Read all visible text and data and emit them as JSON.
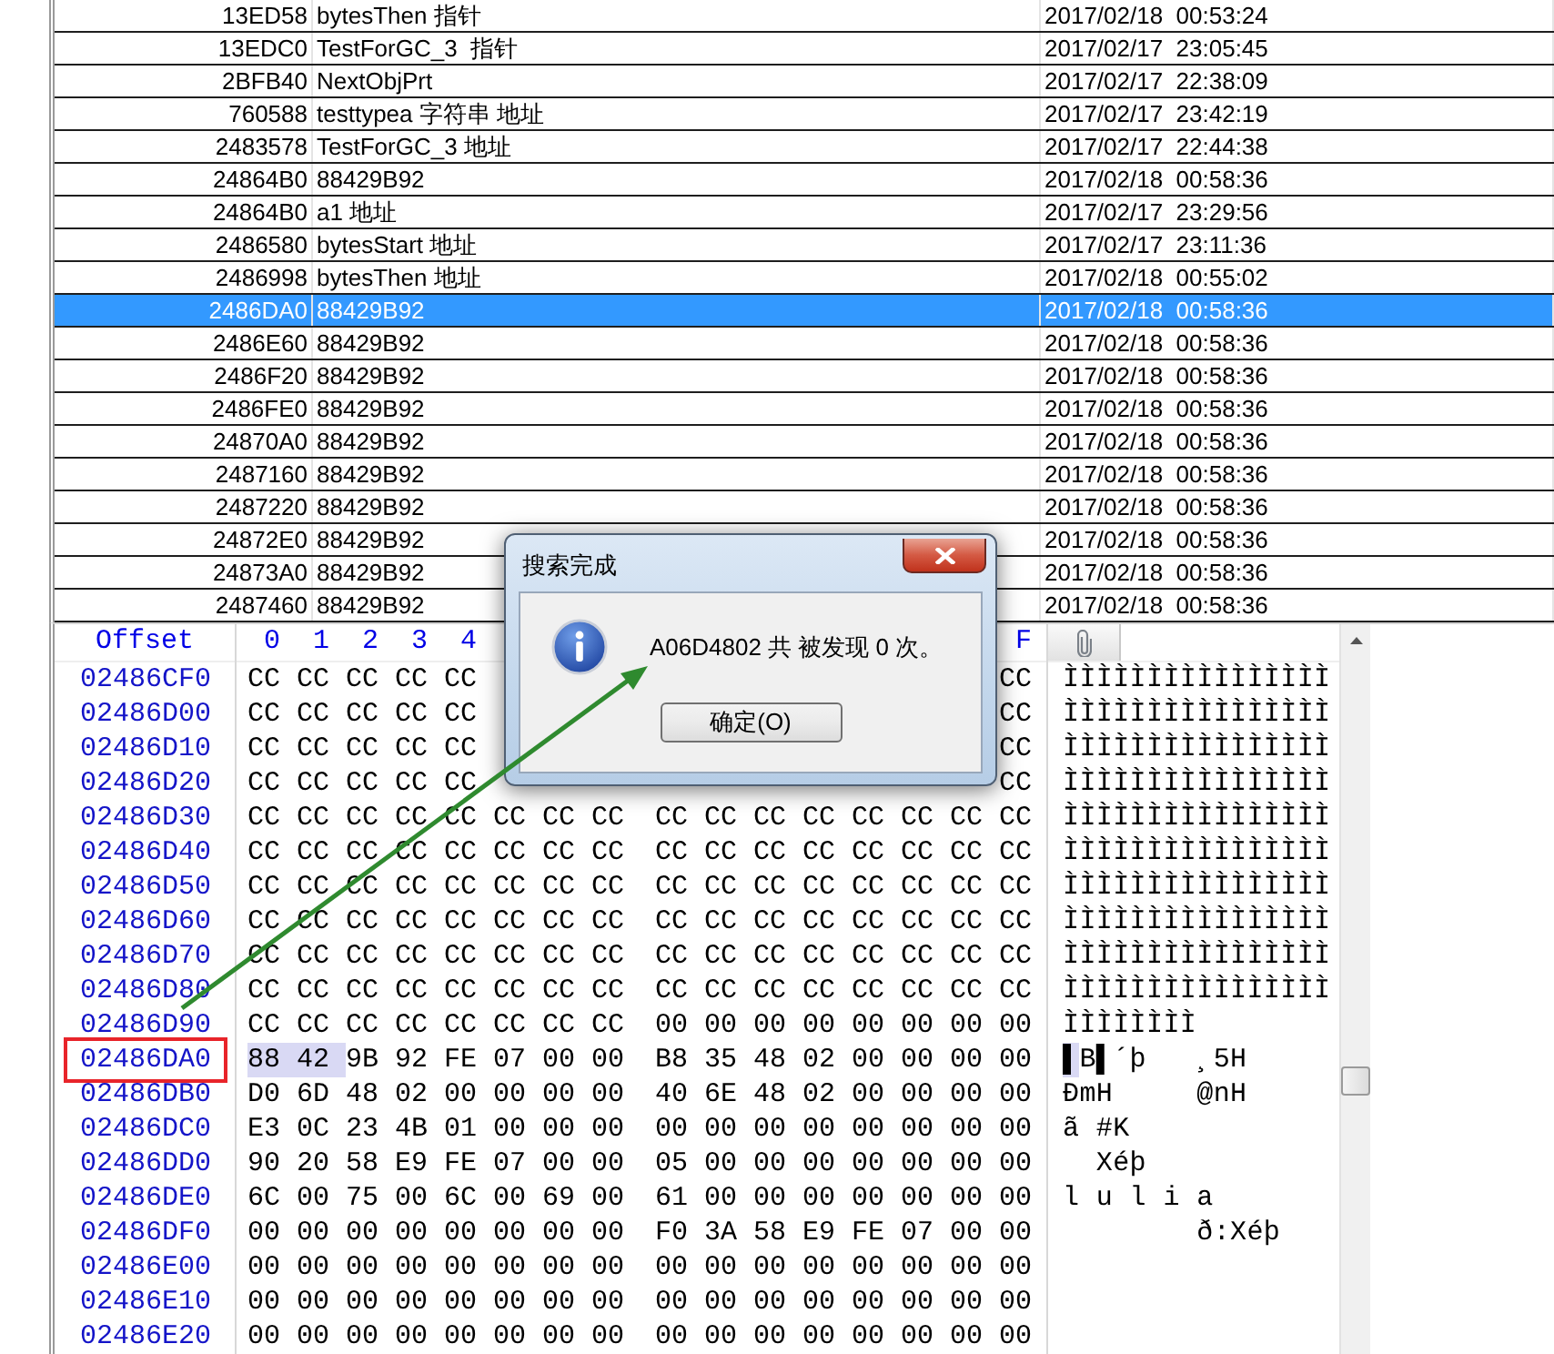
{
  "results_table": {
    "rows": [
      {
        "address": "13ED58",
        "name": "bytesThen 指针",
        "date": "2017/02/18  00:53:24",
        "selected": false
      },
      {
        "address": "13EDC0",
        "name": "TestForGC_3  指针",
        "date": "2017/02/17  23:05:45",
        "selected": false
      },
      {
        "address": "2BFB40",
        "name": "NextObjPrt",
        "date": "2017/02/17  22:38:09",
        "selected": false
      },
      {
        "address": "760588",
        "name": "testtypea 字符串 地址",
        "date": "2017/02/17  23:42:19",
        "selected": false
      },
      {
        "address": "2483578",
        "name": "TestForGC_3 地址",
        "date": "2017/02/17  22:44:38",
        "selected": false
      },
      {
        "address": "24864B0",
        "name": "88429B92",
        "date": "2017/02/18  00:58:36",
        "selected": false
      },
      {
        "address": "24864B0",
        "name": "a1 地址",
        "date": "2017/02/17  23:29:56",
        "selected": false
      },
      {
        "address": "2486580",
        "name": "bytesStart 地址",
        "date": "2017/02/17  23:11:36",
        "selected": false
      },
      {
        "address": "2486998",
        "name": "bytesThen 地址",
        "date": "2017/02/18  00:55:02",
        "selected": false
      },
      {
        "address": "2486DA0",
        "name": "88429B92",
        "date": "2017/02/18  00:58:36",
        "selected": true
      },
      {
        "address": "2486E60",
        "name": "88429B92",
        "date": "2017/02/18  00:58:36",
        "selected": false
      },
      {
        "address": "2486F20",
        "name": "88429B92",
        "date": "2017/02/18  00:58:36",
        "selected": false
      },
      {
        "address": "2486FE0",
        "name": "88429B92",
        "date": "2017/02/18  00:58:36",
        "selected": false
      },
      {
        "address": "24870A0",
        "name": "88429B92",
        "date": "2017/02/18  00:58:36",
        "selected": false
      },
      {
        "address": "2487160",
        "name": "88429B92",
        "date": "2017/02/18  00:58:36",
        "selected": false
      },
      {
        "address": "2487220",
        "name": "88429B92",
        "date": "2017/02/18  00:58:36",
        "selected": false
      },
      {
        "address": "24872E0",
        "name": "88429B92",
        "date": "2017/02/18  00:58:36",
        "selected": false
      },
      {
        "address": "24873A0",
        "name": "88429B92",
        "date": "2017/02/18  00:58:36",
        "selected": false
      },
      {
        "address": "2487460",
        "name": "88429B92",
        "date": "2017/02/18  00:58:36",
        "selected": false
      }
    ]
  },
  "hex_view": {
    "offset_header": "Offset",
    "column_headers": [
      "0",
      "1",
      "2",
      "3",
      "4"
    ],
    "column_headers_end": [
      "F"
    ],
    "rows": [
      {
        "offset": "02486CF0",
        "flagged": false,
        "bytes": [
          "CC",
          "CC",
          "CC",
          "CC",
          "CC"
        ],
        "bytes_end": [
          "CC"
        ],
        "ascii": "ÌÌÌÌÌÌÌÌÌÌÌÌÌÌÌÌ"
      },
      {
        "offset": "02486D00",
        "flagged": false,
        "bytes": [
          "CC",
          "CC",
          "CC",
          "CC",
          "CC"
        ],
        "bytes_end": [
          "CC"
        ],
        "ascii": "ÌÌÌÌÌÌÌÌÌÌÌÌÌÌÌÌ"
      },
      {
        "offset": "02486D10",
        "flagged": false,
        "bytes": [
          "CC",
          "CC",
          "CC",
          "CC",
          "CC"
        ],
        "bytes_end": [
          "CC"
        ],
        "ascii": "ÌÌÌÌÌÌÌÌÌÌÌÌÌÌÌÌ"
      },
      {
        "offset": "02486D20",
        "flagged": false,
        "bytes": [
          "CC",
          "CC",
          "CC",
          "CC",
          "CC"
        ],
        "bytes_end": [
          "CC"
        ],
        "ascii": "ÌÌÌÌÌÌÌÌÌÌÌÌÌÌÌÌ"
      },
      {
        "offset": "02486D30",
        "flagged": false,
        "bytes": [
          "CC",
          "CC",
          "CC",
          "CC",
          "CC",
          "CC",
          "CC",
          "CC",
          "CC",
          "CC",
          "CC",
          "CC",
          "CC",
          "CC",
          "CC",
          "CC"
        ],
        "ascii": "ÌÌÌÌÌÌÌÌÌÌÌÌÌÌÌÌ"
      },
      {
        "offset": "02486D40",
        "flagged": false,
        "bytes": [
          "CC",
          "CC",
          "CC",
          "CC",
          "CC",
          "CC",
          "CC",
          "CC",
          "CC",
          "CC",
          "CC",
          "CC",
          "CC",
          "CC",
          "CC",
          "CC"
        ],
        "ascii": "ÌÌÌÌÌÌÌÌÌÌÌÌÌÌÌÌ"
      },
      {
        "offset": "02486D50",
        "flagged": false,
        "bytes": [
          "CC",
          "CC",
          "CC",
          "CC",
          "CC",
          "CC",
          "CC",
          "CC",
          "CC",
          "CC",
          "CC",
          "CC",
          "CC",
          "CC",
          "CC",
          "CC"
        ],
        "ascii": "ÌÌÌÌÌÌÌÌÌÌÌÌÌÌÌÌ"
      },
      {
        "offset": "02486D60",
        "flagged": false,
        "bytes": [
          "CC",
          "CC",
          "CC",
          "CC",
          "CC",
          "CC",
          "CC",
          "CC",
          "CC",
          "CC",
          "CC",
          "CC",
          "CC",
          "CC",
          "CC",
          "CC"
        ],
        "ascii": "ÌÌÌÌÌÌÌÌÌÌÌÌÌÌÌÌ"
      },
      {
        "offset": "02486D70",
        "flagged": false,
        "bytes": [
          "CC",
          "CC",
          "CC",
          "CC",
          "CC",
          "CC",
          "CC",
          "CC",
          "CC",
          "CC",
          "CC",
          "CC",
          "CC",
          "CC",
          "CC",
          "CC"
        ],
        "ascii": "ÌÌÌÌÌÌÌÌÌÌÌÌÌÌÌÌ"
      },
      {
        "offset": "02486D80",
        "flagged": false,
        "bytes": [
          "CC",
          "CC",
          "CC",
          "CC",
          "CC",
          "CC",
          "CC",
          "CC",
          "CC",
          "CC",
          "CC",
          "CC",
          "CC",
          "CC",
          "CC",
          "CC"
        ],
        "ascii": "ÌÌÌÌÌÌÌÌÌÌÌÌÌÌÌÌ"
      },
      {
        "offset": "02486D90",
        "flagged": false,
        "bytes": [
          "CC",
          "CC",
          "CC",
          "CC",
          "CC",
          "CC",
          "CC",
          "CC",
          "00",
          "00",
          "00",
          "00",
          "00",
          "00",
          "00",
          "00"
        ],
        "ascii": "ÌÌÌÌÌÌÌÌ"
      },
      {
        "offset": "02486DA0",
        "flagged": true,
        "bytes": [
          {
            "value": "88",
            "selected": true
          },
          {
            "value": "42",
            "selected": true
          },
          "9B",
          "92",
          "FE",
          "07",
          "00",
          "00",
          "B8",
          "35",
          "48",
          "02",
          "00",
          "00",
          "00",
          "00"
        ],
        "ascii_selected": "▌",
        "ascii": "B▌´þ   ¸5H"
      },
      {
        "offset": "02486DB0",
        "flagged": false,
        "bytes": [
          "D0",
          "6D",
          "48",
          "02",
          "00",
          "00",
          "00",
          "00",
          "40",
          "6E",
          "48",
          "02",
          "00",
          "00",
          "00",
          "00"
        ],
        "ascii": "ÐmH     @nH"
      },
      {
        "offset": "02486DC0",
        "flagged": false,
        "bytes": [
          "E3",
          "0C",
          "23",
          "4B",
          "01",
          "00",
          "00",
          "00",
          "00",
          "00",
          "00",
          "00",
          "00",
          "00",
          "00",
          "00"
        ],
        "ascii": "ã #K"
      },
      {
        "offset": "02486DD0",
        "flagged": false,
        "bytes": [
          "90",
          "20",
          "58",
          "E9",
          "FE",
          "07",
          "00",
          "00",
          "05",
          "00",
          "00",
          "00",
          "00",
          "00",
          "00",
          "00"
        ],
        "ascii": "  Xéþ"
      },
      {
        "offset": "02486DE0",
        "flagged": false,
        "bytes": [
          "6C",
          "00",
          "75",
          "00",
          "6C",
          "00",
          "69",
          "00",
          "61",
          "00",
          "00",
          "00",
          "00",
          "00",
          "00",
          "00"
        ],
        "ascii": "l u l i a"
      },
      {
        "offset": "02486DF0",
        "flagged": false,
        "bytes": [
          "00",
          "00",
          "00",
          "00",
          "00",
          "00",
          "00",
          "00",
          "F0",
          "3A",
          "58",
          "E9",
          "FE",
          "07",
          "00",
          "00"
        ],
        "ascii": "        ð:Xéþ"
      },
      {
        "offset": "02486E00",
        "flagged": false,
        "bytes": [
          "00",
          "00",
          "00",
          "00",
          "00",
          "00",
          "00",
          "00",
          "00",
          "00",
          "00",
          "00",
          "00",
          "00",
          "00",
          "00"
        ]
      },
      {
        "offset": "02486E10",
        "flagged": false,
        "bytes": [
          "00",
          "00",
          "00",
          "00",
          "00",
          "00",
          "00",
          "00",
          "00",
          "00",
          "00",
          "00",
          "00",
          "00",
          "00",
          "00"
        ]
      },
      {
        "offset": "02486E20",
        "flagged": false,
        "bytes": [
          "00",
          "00",
          "00",
          "00",
          "00",
          "00",
          "00",
          "00",
          "00",
          "00",
          "00",
          "00",
          "00",
          "00",
          "00",
          "00"
        ]
      }
    ]
  },
  "dialog": {
    "title": "搜索完成",
    "message": "A06D4802 共 被发现 0 次。",
    "buttons": [
      "确定(O)"
    ]
  }
}
